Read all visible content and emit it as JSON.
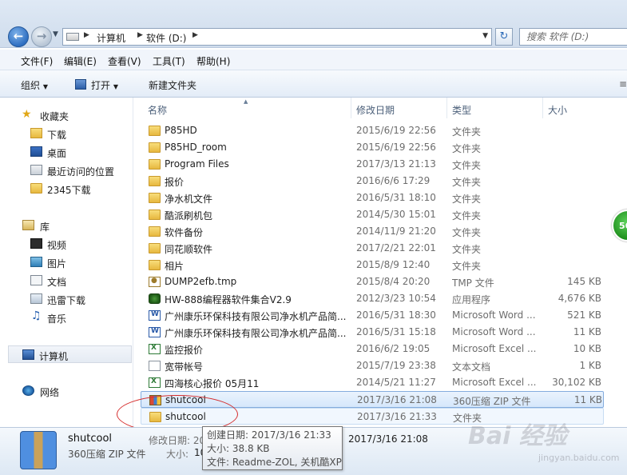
{
  "address_bar": {
    "crumbs": [
      "计算机",
      "软件 (D:)"
    ],
    "search_placeholder": "搜索 软件 (D:)"
  },
  "menu": [
    "文件(F)",
    "编辑(E)",
    "查看(V)",
    "工具(T)",
    "帮助(H)"
  ],
  "command_bar": {
    "organize": "组织",
    "open": "打开",
    "new_folder": "新建文件夹"
  },
  "sidebar": {
    "favorites_label": "收藏夹",
    "favorites": [
      "下载",
      "桌面",
      "最近访问的位置",
      "2345下载"
    ],
    "libraries_label": "库",
    "libraries": [
      "视频",
      "图片",
      "文档",
      "迅雷下载",
      "音乐"
    ],
    "computer": "计算机",
    "network": "网络"
  },
  "columns": {
    "name": "名称",
    "date": "修改日期",
    "type": "类型",
    "size": "大小"
  },
  "files": [
    {
      "icon": "folder-icon",
      "name": "P85HD",
      "date": "2015/6/19 22:56",
      "type": "文件夹",
      "size": ""
    },
    {
      "icon": "folder-icon",
      "name": "P85HD_room",
      "date": "2015/6/19 22:56",
      "type": "文件夹",
      "size": ""
    },
    {
      "icon": "folder-icon",
      "name": "Program Files",
      "date": "2017/3/13 21:13",
      "type": "文件夹",
      "size": ""
    },
    {
      "icon": "folder-icon",
      "name": "报价",
      "date": "2016/6/6 17:29",
      "type": "文件夹",
      "size": ""
    },
    {
      "icon": "folder-icon",
      "name": "净水机文件",
      "date": "2016/5/31 18:10",
      "type": "文件夹",
      "size": ""
    },
    {
      "icon": "folder-icon",
      "name": "酷派刷机包",
      "date": "2014/5/30 15:01",
      "type": "文件夹",
      "size": ""
    },
    {
      "icon": "folder-icon",
      "name": "软件备份",
      "date": "2014/11/9 21:20",
      "type": "文件夹",
      "size": ""
    },
    {
      "icon": "folder-icon",
      "name": "同花顺软件",
      "date": "2017/2/21 22:01",
      "type": "文件夹",
      "size": ""
    },
    {
      "icon": "folder-icon",
      "name": "相片",
      "date": "2015/8/9 12:40",
      "type": "文件夹",
      "size": ""
    },
    {
      "icon": "tmp-file-icon",
      "name": "DUMP2efb.tmp",
      "date": "2015/8/4 20:20",
      "type": "TMP 文件",
      "size": "145 KB"
    },
    {
      "icon": "app-icon",
      "name": "HW-888编程器软件集合V2.9",
      "date": "2012/3/23 10:54",
      "type": "应用程序",
      "size": "4,676 KB"
    },
    {
      "icon": "word-doc-icon",
      "name": "广州康乐环保科技有限公司净水机产品简...",
      "date": "2016/5/31 18:30",
      "type": "Microsoft Word ...",
      "size": "521 KB"
    },
    {
      "icon": "word-doc-icon",
      "name": "广州康乐环保科技有限公司净水机产品简...",
      "date": "2016/5/31 15:18",
      "type": "Microsoft Word ...",
      "size": "11 KB"
    },
    {
      "icon": "excel-doc-icon",
      "name": "监控报价",
      "date": "2016/6/2 19:05",
      "type": "Microsoft Excel ...",
      "size": "10 KB"
    },
    {
      "icon": "text-file-icon",
      "name": "宽带帐号",
      "date": "2015/7/19 23:38",
      "type": "文本文档",
      "size": "1 KB"
    },
    {
      "icon": "excel-doc-icon",
      "name": "四海核心报价 05月11",
      "date": "2014/5/21 11:27",
      "type": "Microsoft Excel ...",
      "size": "30,102 KB"
    },
    {
      "icon": "zip-archive-icon",
      "name": "shutcool",
      "date": "2017/3/16 21:08",
      "type": "360压缩 ZIP 文件",
      "size": "11 KB"
    },
    {
      "icon": "folder-icon",
      "name": "shutcool",
      "date": "2017/3/16 21:33",
      "type": "文件夹",
      "size": ""
    }
  ],
  "details_pane": {
    "name": "shutcool",
    "type": "360压缩 ZIP 文件",
    "modified_label": "修改日期: 20",
    "modified_value": "2017/3/16 21:08",
    "size_label": "大小:",
    "size_value": "10"
  },
  "tooltip": {
    "created": "创建日期: 2017/3/16 21:33",
    "size": "大小: 38.8 KB",
    "files": "文件: Readme-ZOL, 关机酷XP"
  },
  "badge": "56",
  "watermark": {
    "main": "Bai 经验",
    "sub": "jingyan.baidu.com"
  }
}
